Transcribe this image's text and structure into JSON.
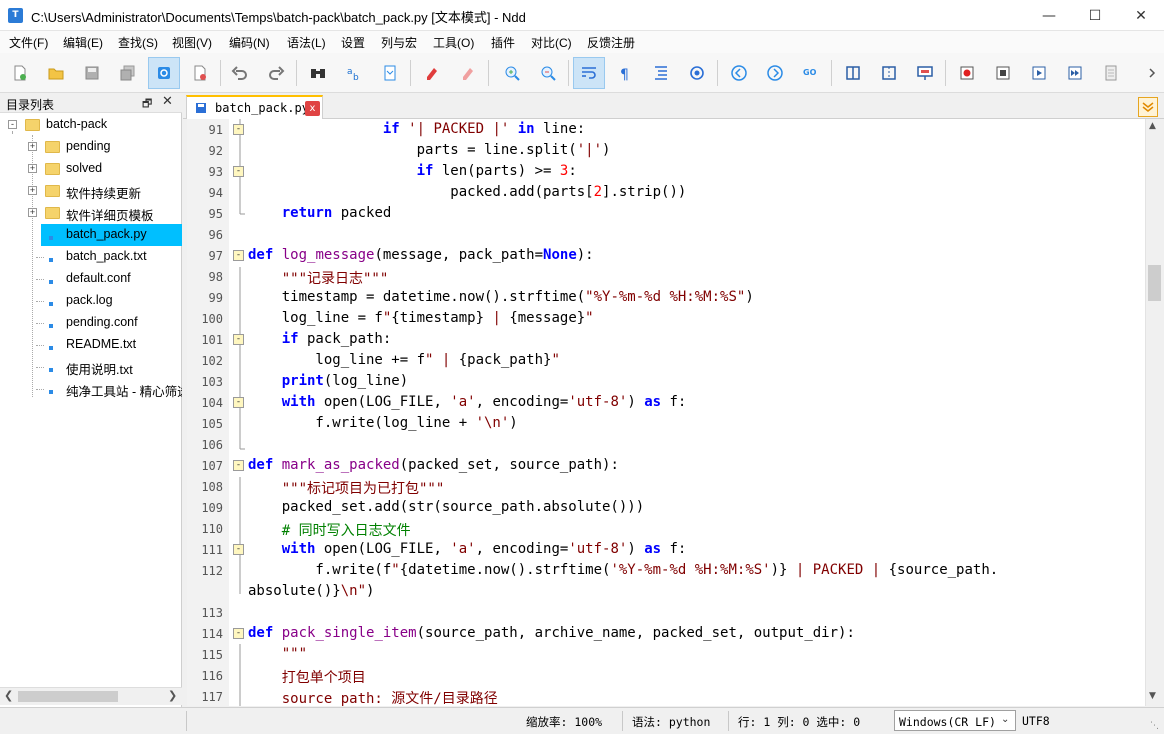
{
  "window": {
    "title": "C:\\Users\\Administrator\\Documents\\Temps\\batch-pack\\batch_pack.py [文本模式] - Ndd",
    "app_icon_letter": "T"
  },
  "menu": [
    "文件(F)",
    "编辑(E)",
    "查找(S)",
    "视图(V)",
    "编码(N)",
    "语法(L)",
    "设置",
    "列与宏",
    "工具(O)",
    "插件",
    "对比(C)",
    "反馈注册"
  ],
  "sidebar": {
    "title": "目录列表",
    "root": "batch-pack",
    "folders": [
      "pending",
      "solved",
      "软件持续更新",
      "软件详细页模板"
    ],
    "files": [
      "batch_pack.py",
      "batch_pack.txt",
      "default.conf",
      "pack.log",
      "pending.conf",
      "README.txt",
      "使用说明.txt",
      "纯净工具站 - 精心筛选"
    ],
    "selected_file": "batch_pack.py"
  },
  "tab": {
    "label": "batch_pack.py",
    "close": "x"
  },
  "editor": {
    "line_numbers": [
      "91",
      "92",
      "93",
      "94",
      "95",
      "96",
      "97",
      "98",
      "99",
      "100",
      "101",
      "102",
      "103",
      "104",
      "105",
      "106",
      "107",
      "108",
      "109",
      "110",
      "111",
      "112",
      "",
      "113",
      "114",
      "115",
      "116",
      "117"
    ]
  },
  "status": {
    "zoom": "缩放率: 100%",
    "syntax": "语法: python",
    "position": "行: 1 列: 0 选中: 0",
    "eol": "Windows(CR LF)",
    "encoding": "UTF8"
  },
  "colors": {
    "keyword": "#0000ff",
    "function": "#880088",
    "string": "#800000",
    "number": "#ff0000",
    "comment": "#008000",
    "selection": "#00bfff",
    "tab_accent": "#ffbf00"
  }
}
